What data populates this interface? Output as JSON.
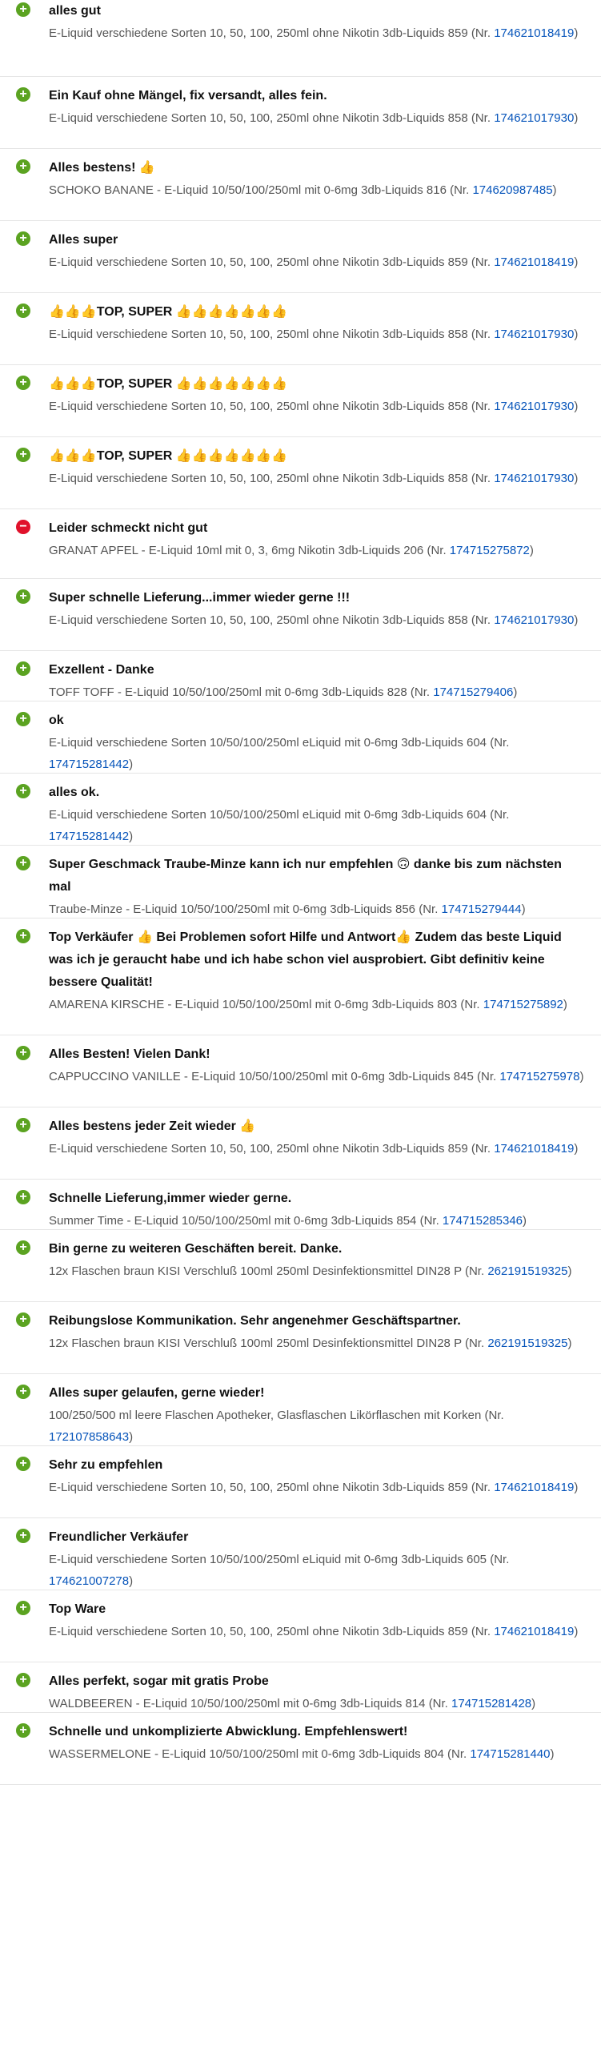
{
  "feedback": [
    {
      "type": "positive",
      "comment": "alles gut",
      "item": "E-Liquid verschiedene Sorten 10, 50, 100, 250ml ohne Nikotin 3db-Liquids 859",
      "item_number": "174621018419"
    },
    {
      "type": "positive",
      "comment": "Ein Kauf ohne Mängel, fix versandt, alles fein.",
      "item": "E-Liquid verschiedene Sorten 10, 50, 100, 250ml ohne Nikotin 3db-Liquids 858",
      "item_number": "174621017930"
    },
    {
      "type": "positive",
      "comment": "Alles bestens! 👍",
      "item": "SCHOKO BANANE - E-Liquid 10/50/100/250ml mit 0-6mg 3db-Liquids 816",
      "item_number": "174620987485"
    },
    {
      "type": "positive",
      "comment": "Alles super",
      "item": "E-Liquid verschiedene Sorten 10, 50, 100, 250ml ohne Nikotin 3db-Liquids 859",
      "item_number": "174621018419"
    },
    {
      "type": "positive",
      "comment": "👍👍👍TOP, SUPER 👍👍👍👍👍👍👍",
      "item": "E-Liquid verschiedene Sorten 10, 50, 100, 250ml ohne Nikotin 3db-Liquids 858",
      "item_number": "174621017930"
    },
    {
      "type": "positive",
      "comment": "👍👍👍TOP, SUPER 👍👍👍👍👍👍👍",
      "item": "E-Liquid verschiedene Sorten 10, 50, 100, 250ml ohne Nikotin 3db-Liquids 858",
      "item_number": "174621017930"
    },
    {
      "type": "positive",
      "comment": "👍👍👍TOP, SUPER 👍👍👍👍👍👍👍",
      "item": "E-Liquid verschiedene Sorten 10, 50, 100, 250ml ohne Nikotin 3db-Liquids 858",
      "item_number": "174621017930"
    },
    {
      "type": "negative",
      "comment": "Leider schmeckt nicht gut",
      "item": "GRANAT APFEL - E-Liquid 10ml mit 0, 3, 6mg Nikotin 3db-Liquids 206",
      "item_number": "174715275872"
    },
    {
      "type": "positive",
      "comment": "Super schnelle Lieferung...immer wieder gerne !!!",
      "item": "E-Liquid verschiedene Sorten 10, 50, 100, 250ml ohne Nikotin 3db-Liquids 858",
      "item_number": "174621017930"
    },
    {
      "type": "positive",
      "comment": "Exzellent - Danke",
      "item": "TOFF TOFF - E-Liquid 10/50/100/250ml mit 0-6mg 3db-Liquids 828",
      "item_number": "174715279406"
    },
    {
      "type": "positive",
      "comment": "ok",
      "item": "E-Liquid verschiedene Sorten 10/50/100/250ml eLiquid mit 0-6mg 3db-Liquids 604",
      "item_number": "174715281442"
    },
    {
      "type": "positive",
      "comment": "alles ok.",
      "item": "E-Liquid verschiedene Sorten 10/50/100/250ml eLiquid mit 0-6mg 3db-Liquids 604",
      "item_number": "174715281442"
    },
    {
      "type": "positive",
      "comment": "Super Geschmack Traube-Minze kann ich nur empfehlen 🙃 danke bis zum nächsten mal",
      "item": "Traube-Minze - E-Liquid 10/50/100/250ml mit 0-6mg 3db-Liquids 856",
      "item_number": "174715279444"
    },
    {
      "type": "positive",
      "comment": "Top Verkäufer 👍 Bei Problemen sofort Hilfe und Antwort👍 Zudem das beste Liquid was ich je geraucht habe und ich habe schon viel ausprobiert. Gibt definitiv keine bessere Qualität!",
      "item": "AMARENA KIRSCHE - E-Liquid 10/50/100/250ml mit 0-6mg 3db-Liquids 803",
      "item_number": "174715275892"
    },
    {
      "type": "positive",
      "comment": "Alles Besten! Vielen Dank!",
      "item": "CAPPUCCINO VANILLE - E-Liquid 10/50/100/250ml mit 0-6mg 3db-Liquids 845",
      "item_number": "174715275978"
    },
    {
      "type": "positive",
      "comment": "Alles bestens jeder Zeit wieder 👍",
      "item": "E-Liquid verschiedene Sorten 10, 50, 100, 250ml ohne Nikotin 3db-Liquids 859",
      "item_number": "174621018419"
    },
    {
      "type": "positive",
      "comment": "Schnelle Lieferung,immer wieder gerne.",
      "item": "Summer Time - E-Liquid 10/50/100/250ml mit 0-6mg 3db-Liquids 854",
      "item_number": "174715285346"
    },
    {
      "type": "positive",
      "comment": "Bin gerne zu weiteren Geschäften bereit. Danke.",
      "item": "12x Flaschen braun KISI Verschluß 100ml 250ml Desinfektionsmittel DIN28 P",
      "item_number": "262191519325"
    },
    {
      "type": "positive",
      "comment": "Reibungslose Kommunikation. Sehr angenehmer Geschäftspartner.",
      "item": "12x Flaschen braun KISI Verschluß 100ml 250ml Desinfektionsmittel DIN28 P",
      "item_number": "262191519325"
    },
    {
      "type": "positive",
      "comment": "Alles super gelaufen, gerne wieder!",
      "item": "100/250/500 ml leere Flaschen Apotheker, Glasflaschen Likörflaschen mit Korken",
      "item_number": "172107858643"
    },
    {
      "type": "positive",
      "comment": "Sehr zu empfehlen",
      "item": "E-Liquid verschiedene Sorten 10, 50, 100, 250ml ohne Nikotin 3db-Liquids 859",
      "item_number": "174621018419"
    },
    {
      "type": "positive",
      "comment": "Freundlicher Verkäufer",
      "item": "E-Liquid verschiedene Sorten 10/50/100/250ml eLiquid mit 0-6mg 3db-Liquids 605",
      "item_number": "174621007278"
    },
    {
      "type": "positive",
      "comment": "Top Ware",
      "item": "E-Liquid verschiedene Sorten 10, 50, 100, 250ml ohne Nikotin 3db-Liquids 859",
      "item_number": "174621018419"
    },
    {
      "type": "positive",
      "comment": "Alles perfekt, sogar mit gratis Probe",
      "item": "WALDBEEREN - E-Liquid 10/50/100/250ml mit 0-6mg 3db-Liquids 814",
      "item_number": "174715281428"
    },
    {
      "type": "positive",
      "comment": "Schnelle und unkomplizierte Abwicklung. Empfehlenswert!",
      "item": "WASSERMELONE - E-Liquid 10/50/100/250ml mit 0-6mg 3db-Liquids 804",
      "item_number": "174715281440"
    }
  ],
  "labels": {
    "item_number_prefix": "(Nr. ",
    "item_number_suffix": ")"
  },
  "colors": {
    "positive": "#5ba321",
    "negative": "#e0112b",
    "link": "#0654ba"
  },
  "icons": {
    "positive": "plus-circle-icon",
    "negative": "minus-circle-icon"
  }
}
